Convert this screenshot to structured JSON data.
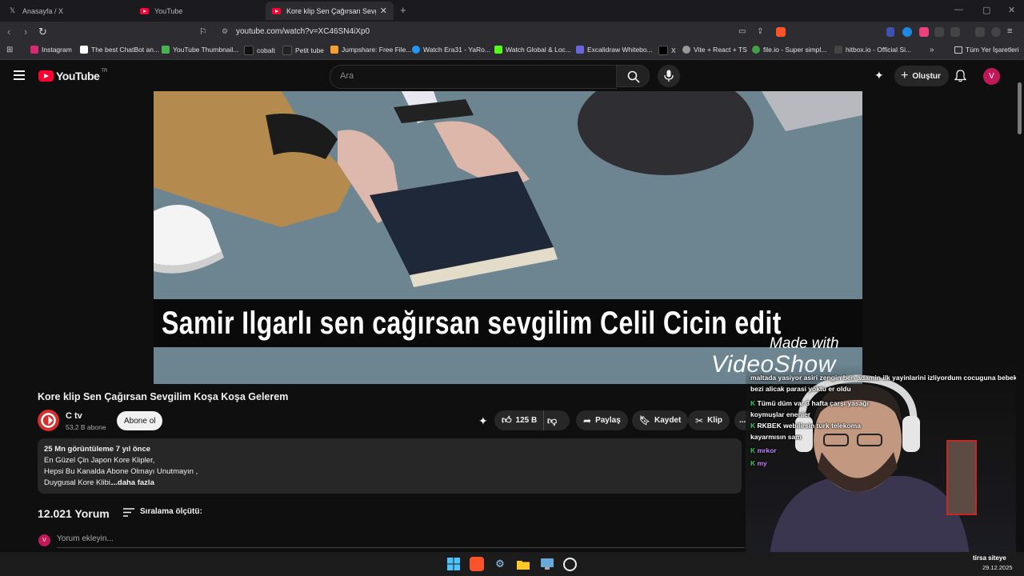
{
  "browser": {
    "tabs": [
      {
        "title": "Anasayfa / X",
        "active": false
      },
      {
        "title": "YouTube",
        "active": false
      },
      {
        "title": "Kore klip Sen Çağırsan Sevgilim Koşa Koşa Gelerem",
        "active": true
      }
    ],
    "new_tab": "+",
    "url": "youtube.com/watch?v=XC46SN4iXp0",
    "window_controls": [
      "—",
      "▢",
      "✕"
    ]
  },
  "bookmarks": {
    "items": [
      {
        "label": "Instagram",
        "icon": "instagram-icon",
        "color": "#d62976"
      },
      {
        "label": "The best ChatBot an...",
        "icon": "chatbot-icon",
        "color": "#ffffff"
      },
      {
        "label": "YouTube Thumbnail...",
        "icon": "thumbnail-icon",
        "color": "#4caf50"
      },
      {
        "label": "cobalt",
        "icon": "cobalt-icon",
        "color": "#111111"
      },
      {
        "label": "Petit tube",
        "icon": "petittube-icon",
        "color": "#222222"
      },
      {
        "label": "Jumpshare: Free File...",
        "icon": "jumpshare-icon",
        "color": "#f7a12b"
      },
      {
        "label": "Watch Era31 - YaRo...",
        "icon": "era31-icon",
        "color": "#2196f3"
      },
      {
        "label": "Watch Global & Loc...",
        "icon": "kick-icon",
        "color": "#53fc18"
      },
      {
        "label": "Excalidraw Whitebo...",
        "icon": "excalidraw-icon",
        "color": "#6965db"
      },
      {
        "label": "X",
        "icon": "x-icon",
        "color": "#000000"
      },
      {
        "label": "Vite + React + TS",
        "icon": "vite-icon",
        "color": "#999999"
      },
      {
        "label": "file.io - Super simpl...",
        "icon": "fileio-icon",
        "color": "#43a047"
      },
      {
        "label": "hitbox.io - Official Si...",
        "icon": "hitbox-icon",
        "color": "#444444"
      }
    ],
    "overflow": "»",
    "all_bookmarks": "Tüm Yer İşaretleri"
  },
  "youtube": {
    "logo_text": "YouTube",
    "logo_sup": "TR",
    "search_placeholder": "Ara",
    "create_label": "Oluştur",
    "avatar_letter": "V"
  },
  "video": {
    "caption": "Samir Ilgarlı sen cağırsan sevgilim Celil Cicin edit",
    "watermark_line1": "Made with",
    "watermark_line2": "VideoShow",
    "title": "Kore klip Sen Çağırsan Sevgilim Koşa Koşa Gelerem"
  },
  "channel": {
    "name": "C tv",
    "subscribers": "53,2 B abone",
    "subscribe_label": "Abone ol"
  },
  "actions": {
    "likes": "125 B",
    "share": "Paylaş",
    "save": "Kaydet",
    "clip": "Klip",
    "more": "..."
  },
  "description": {
    "stats": "25 Mn görüntüleme  7 yıl önce",
    "line1": "En Güzel Çin Japon Kore Klipler,",
    "line2": "Hepsi Bu Kanalda Abone Olmayı Unutmayın ,",
    "line3": "Duygusal Kore Klibi.",
    "more": "...daha fazla"
  },
  "comments": {
    "count": "12.021 Yorum",
    "sort_label": "Sıralama ölçütü:",
    "add_placeholder": "Yorum ekleyin...",
    "user_letter": "V"
  },
  "overlay": {
    "chat": [
      "maltada yasiyor asiri zengin ben adamin ilk yayinlarini izliyordum cocuguna bebek",
      "bezi alicak parasi yoktu                        er oldu",
      "Tümü                          düm var 3 hafta çarşı yasağı",
      "koymuşlar                                        enenler",
      "RKBEK                                 webilirsin turk telekoma",
      "kayarmısın sam",
      "mrkor",
      "my"
    ],
    "tray_text": "tirsa siteye",
    "date": "29.12.2025"
  },
  "colors": {
    "accent": "#ff0033",
    "background": "#0f0f0f",
    "pill": "#272727"
  }
}
